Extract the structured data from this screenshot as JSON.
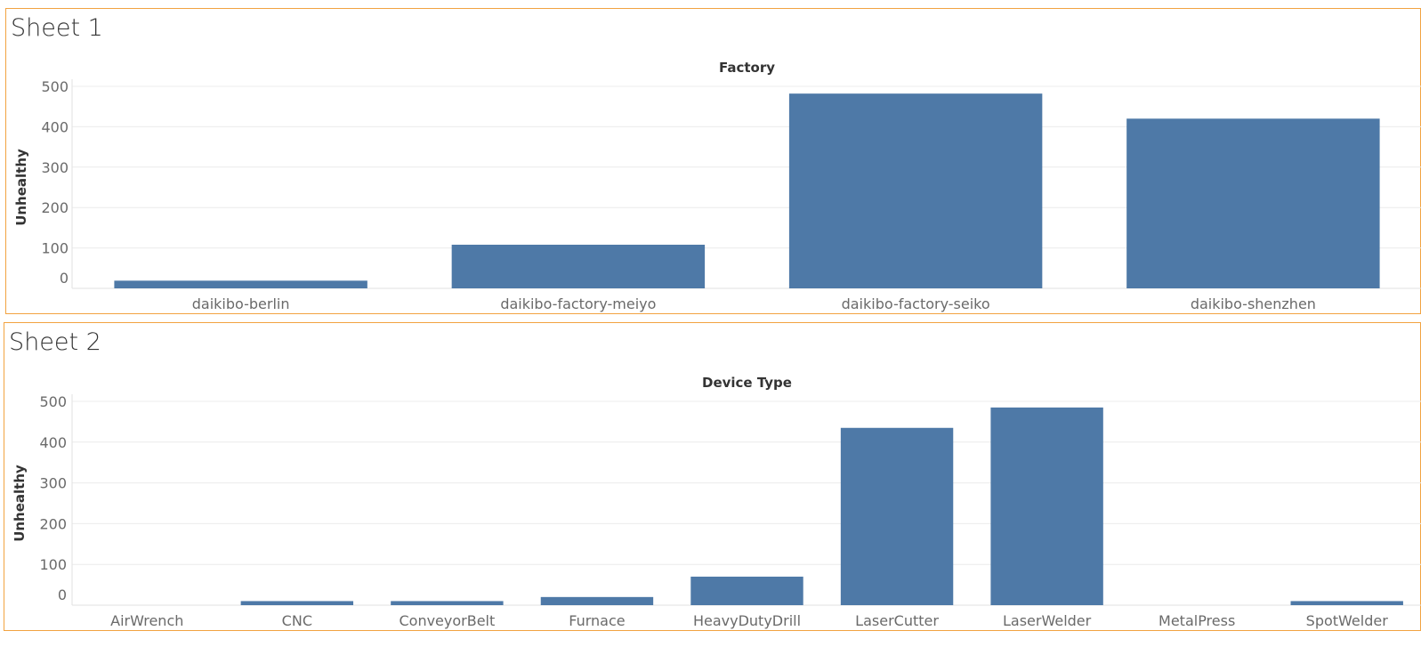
{
  "chart_data": [
    {
      "type": "bar",
      "title": "Sheet 1",
      "column_header": "Factory",
      "xlabel": "",
      "ylabel": "Unhealthy",
      "ylim": [
        0,
        500
      ],
      "yticks": [
        0,
        100,
        200,
        300,
        400,
        500
      ],
      "categories": [
        "daikibo-berlin",
        "daikibo-factory-meiyo",
        "daikibo-factory-seiko",
        "daikibo-shenzhen"
      ],
      "values": [
        19,
        108,
        482,
        420
      ],
      "bar_color": "#4e79a7",
      "grid": true
    },
    {
      "type": "bar",
      "title": "Sheet 2",
      "column_header": "Device Type",
      "xlabel": "",
      "ylabel": "Unhealthy",
      "ylim": [
        0,
        500
      ],
      "yticks": [
        0,
        100,
        200,
        300,
        400,
        500
      ],
      "categories": [
        "AirWrench",
        "CNC",
        "ConveyorBelt",
        "Furnace",
        "HeavyDutyDrill",
        "LaserCutter",
        "LaserWelder",
        "MetalPress",
        "SpotWelder"
      ],
      "values": [
        0,
        10,
        10,
        20,
        70,
        435,
        485,
        0,
        10
      ],
      "bar_color": "#4e79a7",
      "grid": true
    }
  ]
}
